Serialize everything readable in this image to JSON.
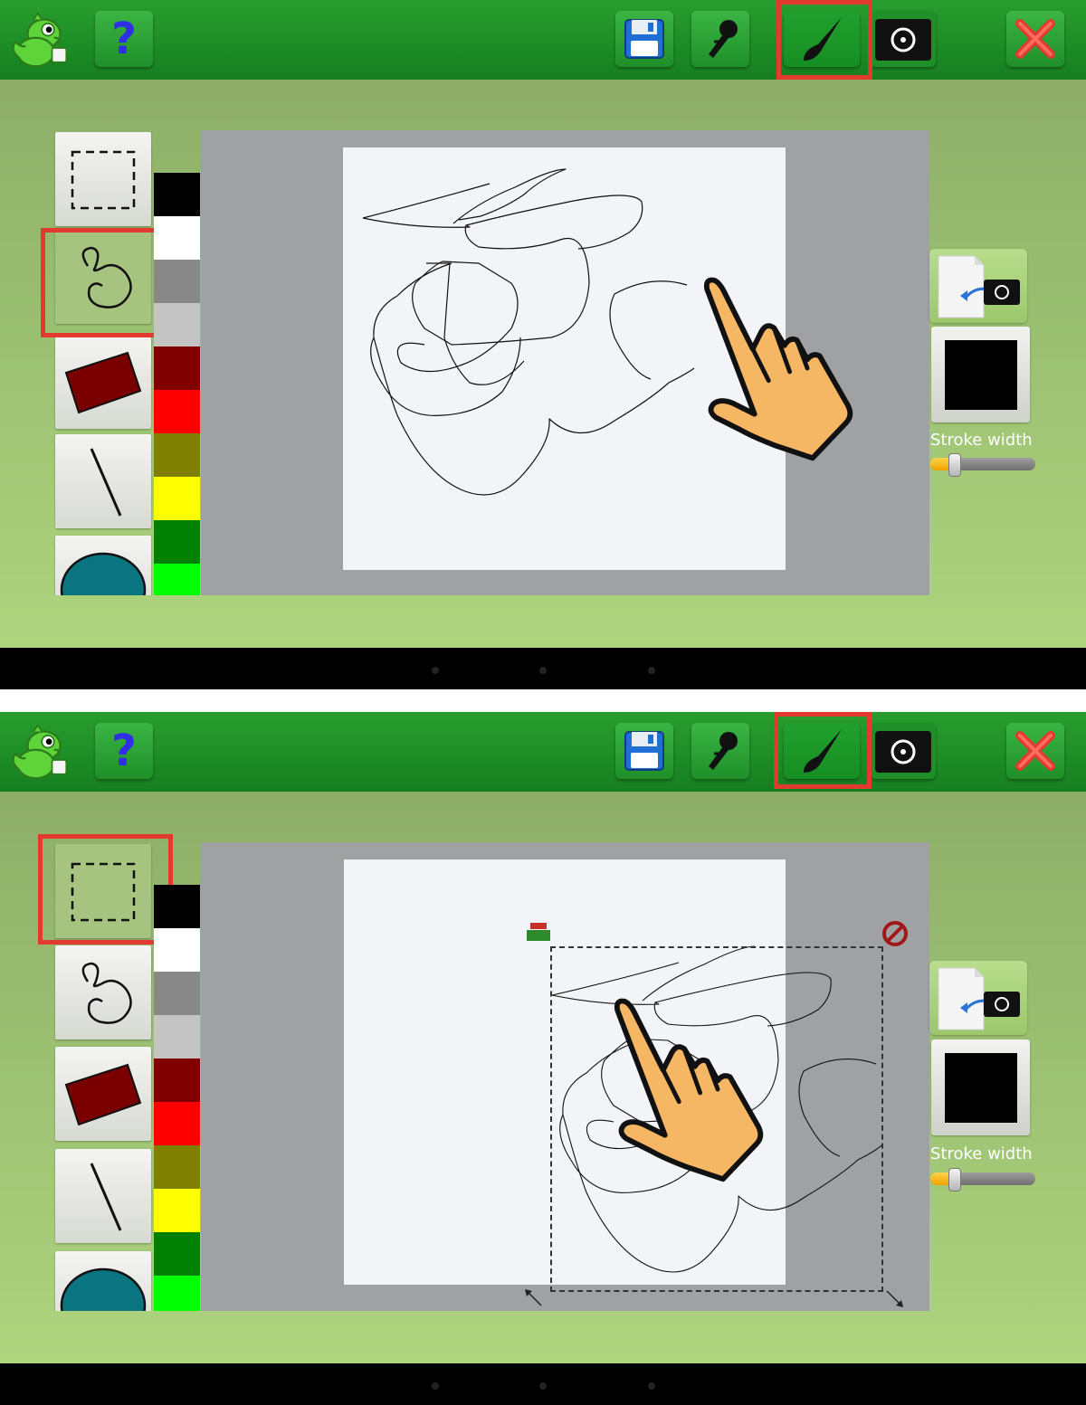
{
  "toolbar": {
    "app_logo": "dragon-mascot-icon",
    "help_label": "?",
    "buttons": [
      "save-icon",
      "microphone-icon",
      "paintbrush-icon",
      "camera-icon",
      "close-icon"
    ]
  },
  "tools": [
    "select-rectangle",
    "freehand",
    "filled-rectangle",
    "line",
    "ellipse"
  ],
  "palette": [
    "#000000",
    "#ffffff",
    "#888888",
    "#c4c4c4",
    "#800000",
    "#ff0000",
    "#808000",
    "#ffff00",
    "#008000",
    "#00ff00"
  ],
  "side_panel": {
    "import_button_icon": "import-photo-icon",
    "stroke_color": "#000000",
    "stroke_width_label": "Stroke width",
    "stroke_width_level": 0.22
  },
  "screens": [
    {
      "selected_tool": "freehand",
      "pointer_target": "freehand drawing on canvas"
    },
    {
      "selected_tool": "select-rectangle",
      "pointer_target": "selection region on canvas"
    }
  ],
  "colors": {
    "highlight": "#e23a2f",
    "topbar": "#1c8e26",
    "background": "#a2c776"
  }
}
